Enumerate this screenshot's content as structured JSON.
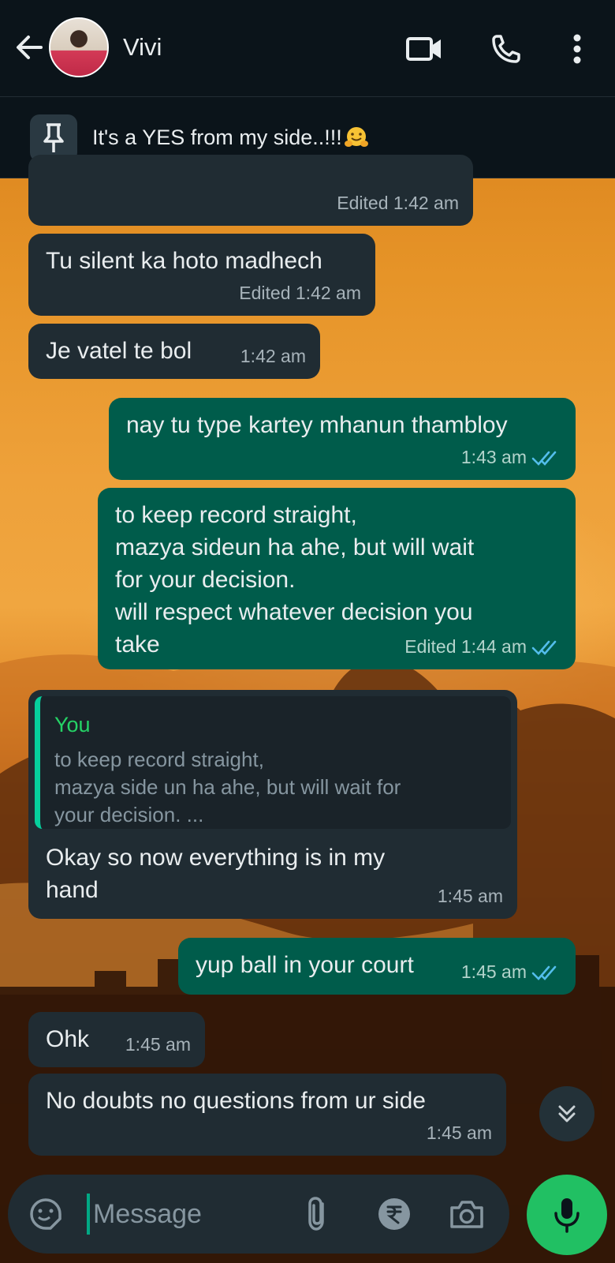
{
  "header": {
    "contact_name": "Vivi",
    "icons": [
      "back-arrow-icon",
      "video-call-icon",
      "voice-call-icon",
      "more-options-icon"
    ]
  },
  "pinned": {
    "text": "It's a YES from my side..!!!",
    "emoji": "hugging-face-emoji"
  },
  "messages": [
    {
      "dir": "in",
      "text": "",
      "time": "Edited 1:42 am"
    },
    {
      "dir": "in",
      "text": "Tu silent ka hoto madhech",
      "time": "Edited 1:42 am"
    },
    {
      "dir": "in",
      "text": "Je vatel te bol",
      "time": "1:42 am"
    },
    {
      "dir": "out",
      "text": "nay tu type kartey mhanun thambloy",
      "time": "1:43 am",
      "status": "read"
    },
    {
      "dir": "out",
      "text": "to keep record straight,\nmazya sideun ha ahe, but will wait\nfor your decision.\nwill respect whatever decision you\ntake",
      "time": "Edited 1:44 am",
      "status": "read"
    },
    {
      "dir": "in",
      "quote": {
        "author": "You",
        "text": "to keep record straight,\nmazya side un ha ahe, but will wait for\nyour decision. ..."
      },
      "text": "Okay so now everything is in my\nhand",
      "time": "1:45 am"
    },
    {
      "dir": "out",
      "text": "yup ball in your court",
      "time": "1:45 am",
      "status": "read"
    },
    {
      "dir": "in",
      "text": "Ohk",
      "time": "1:45 am"
    },
    {
      "dir": "in",
      "text": "No doubts no questions from ur side",
      "time": "1:45 am"
    }
  ],
  "composer": {
    "placeholder": "Message",
    "icons": [
      "sticker-icon",
      "attach-icon",
      "rupee-payment-icon",
      "camera-icon",
      "mic-icon"
    ]
  },
  "colors": {
    "incoming": "#202c33",
    "outgoing": "#005c4b",
    "accent": "#21c063",
    "read_tick": "#53bdeb"
  }
}
